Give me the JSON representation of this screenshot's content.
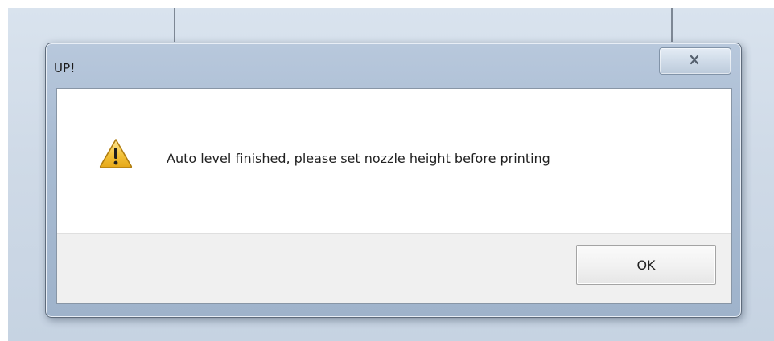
{
  "dialog": {
    "title": "UP!",
    "message": "Auto level finished, please set nozzle height before printing",
    "icon": "warning-icon",
    "buttons": {
      "ok_label": "OK"
    },
    "title_bar_buttons": [
      "close-icon"
    ]
  },
  "colors": {
    "warning_fill": "#f3c23a",
    "warning_outline": "#b07d10",
    "frame_tint": "#a8bbd2",
    "close_glyph": "#55606e"
  }
}
